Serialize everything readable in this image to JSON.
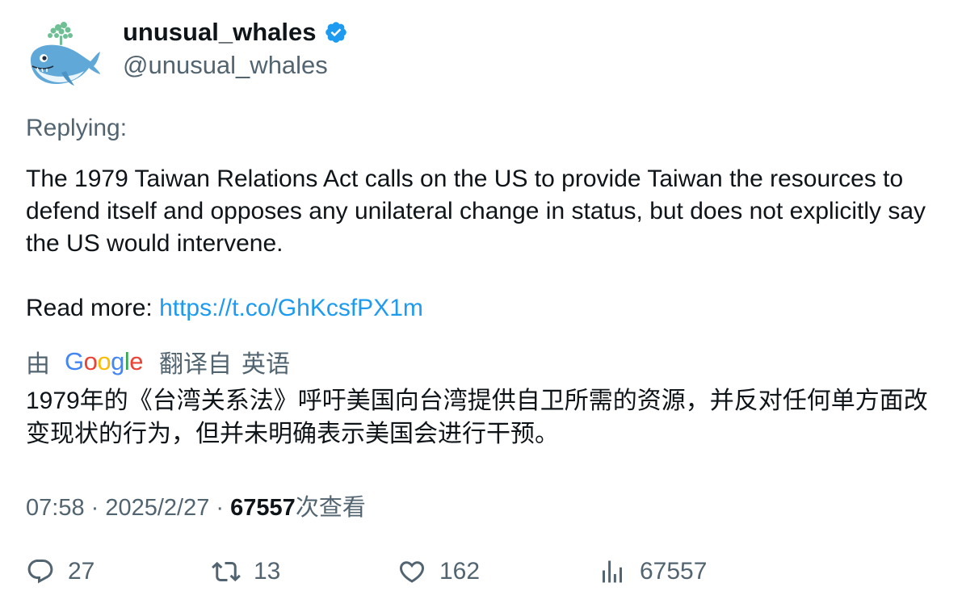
{
  "author": {
    "display_name": "unusual_whales",
    "handle": "@unusual_whales",
    "avatar_icon": "whale-avatar-icon",
    "verified_icon": "verified-badge-icon",
    "verified_color": "#1d9bf0"
  },
  "replying_label": "Replying:",
  "tweet": {
    "text_line1": "The 1979 Taiwan Relations Act calls on the US to provide Taiwan the resources to defend itself and opposes any unilateral change in status, but does not explicitly say the US would intervene.",
    "read_more_label": "Read more: ",
    "link_text": "https://t.co/GhKcsfPX1m",
    "link_color": "#1d9bf0"
  },
  "translation": {
    "by_label": "由",
    "provider": "Google",
    "from_label": "翻译自",
    "language": "英语",
    "text": "1979年的《台湾关系法》呼吁美国向台湾提供自卫所需的资源，并反对任何单方面改变现状的行为，但并未明确表示美国会进行干预。"
  },
  "meta": {
    "time": "07:58",
    "separator1": " · ",
    "date": "2025/2/27",
    "separator2": " · ",
    "views_count": "67557",
    "views_label": "次查看"
  },
  "actions": {
    "replies": "27",
    "retweets": "13",
    "likes": "162",
    "views": "67557",
    "icon_color": "#536471"
  }
}
